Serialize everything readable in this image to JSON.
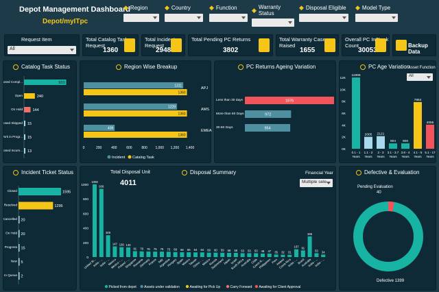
{
  "header": {
    "title": "Depot Management Dashboard",
    "subtitle": "Depot/myITpc"
  },
  "filters": [
    {
      "label": "Region",
      "icon": "map-pin-icon"
    },
    {
      "label": "Country",
      "icon": "globe-icon"
    },
    {
      "label": "Function",
      "icon": "function-icon"
    },
    {
      "label": "Warranty Status",
      "icon": "warranty-icon"
    },
    {
      "label": "Disposal Eligible",
      "icon": "disposal-icon"
    },
    {
      "label": "Model Type",
      "icon": "model-icon"
    }
  ],
  "request_item": {
    "label": "Request Item",
    "value": "All"
  },
  "kpis": [
    {
      "label": "Total Catalog Task Request",
      "value": "1360"
    },
    {
      "label": "Total Incident Request",
      "value": "2948"
    },
    {
      "label": "Total Pending PC Returns",
      "value": "3802"
    },
    {
      "label": "Total Warranty Case Raised",
      "value": "1655"
    },
    {
      "label": "Overall PC InStock Count",
      "value": "30053"
    }
  ],
  "backup": {
    "label": "Backup Data"
  },
  "colors": {
    "teal": "#17b3a3",
    "yellow": "#f5c518",
    "coral": "#f0706a",
    "lightblue": "#a7d8ec",
    "red": "#f2545b",
    "steel": "#4e8fa0",
    "panel": "#0e2a36",
    "bg": "#1c3a48"
  },
  "catalog_task": {
    "title": "Catalog Task Status",
    "chart_data": {
      "type": "bar",
      "categories": [
        "Closed Compl...",
        "Open",
        "On Hold",
        "Closed Skipped",
        "Work in Progr...",
        "Closed Incom..."
      ],
      "values": [
        933,
        240,
        144,
        15,
        15,
        13
      ]
    }
  },
  "region": {
    "title": "Region Wise Breakup",
    "legend": [
      "Incident",
      "Catalog Task"
    ],
    "chart_data": {
      "type": "bar",
      "categories": [
        "APJ",
        "AMS",
        "EMEA"
      ],
      "series": [
        {
          "name": "Incident",
          "values": [
            1311,
            1229,
            408
          ]
        },
        {
          "name": "Catalog Task",
          "values": [
            1360,
            1360,
            1360
          ]
        }
      ],
      "xticks": [
        "0",
        "200",
        "400",
        "600",
        "800",
        "1,000",
        "1,200",
        "1,400"
      ],
      "xlim": [
        0,
        1400
      ]
    }
  },
  "ageing": {
    "title": "PC Returns Ageing Variation",
    "chart_data": {
      "type": "bar",
      "categories": [
        "Less than 30 days",
        "More than 60 Days",
        "30-60 Days"
      ],
      "values": [
        1876,
        972,
        954
      ]
    }
  },
  "age": {
    "title": "PC Age Variation",
    "filter_label": "Asset Function",
    "filter_value": "All",
    "chart_data": {
      "type": "bar",
      "categories": [
        "0.1 - 1 Years",
        "1.1 - 2 Years",
        "2 - 3 Years",
        "3.1 - 3.7 Years",
        "3.8 - 4 Years",
        "4.1 - 5 Years",
        "5.1 - 17 Years"
      ],
      "values": [
        11998,
        2005,
        2121,
        904,
        906,
        7864,
        4055
      ],
      "yticks": [
        "0K",
        "2K",
        "4K",
        "6K",
        "8K",
        "10K",
        "12K"
      ],
      "ylim": [
        0,
        12000
      ]
    }
  },
  "incident": {
    "title": "Incident Ticket Status",
    "chart_data": {
      "type": "bar",
      "categories": [
        "Closed",
        "Resolved",
        "Cancelled",
        "On Hold",
        "In Progress",
        "New",
        "In Queue"
      ],
      "values": [
        1595,
        1295,
        20,
        20,
        15,
        5,
        2
      ]
    }
  },
  "disposal": {
    "title": "Disposal Summary",
    "total_label": "Total Disposal Unit",
    "total_value": "4011",
    "year_label": "Financial Year",
    "year_value": "Multiple sele...",
    "legend": [
      "Picked from depot",
      "Assets under validation",
      "Awaiting for Pick Up",
      "Carry Forward",
      "Awaiting for Client Approval"
    ],
    "chart_data": {
      "type": "bar",
      "categories": [
        "United St...",
        "India - ...",
        "India - ...",
        "Mexico",
        "Mexico - ...",
        "Poland - ...",
        "Singapore",
        "Romania",
        "Germany",
        "France",
        "Italy",
        "Argentina",
        "Hungary",
        "Spain",
        "Mexico",
        "Taiwan",
        "China - ...",
        "Mexico",
        "Russia",
        "Switzerland",
        "Japan",
        "Israel",
        "South Africa",
        "Australia",
        "Chile",
        "Czech R...",
        "Philippines",
        "Peru",
        "Ireland",
        "Costa Rica",
        "India - ...",
        "Brazil",
        "Australia",
        "India - ...",
        "India - ..."
      ],
      "values": [
        1008,
        939,
        300,
        147,
        136,
        133,
        81,
        78,
        76,
        75,
        75,
        73,
        69,
        66,
        66,
        64,
        64,
        60,
        60,
        59,
        58,
        58,
        53,
        53,
        53,
        48,
        47,
        35,
        32,
        31,
        107,
        91,
        285,
        53,
        34
      ],
      "yticks": [
        "0",
        "200",
        "400",
        "600",
        "800",
        "1000"
      ],
      "ylim": [
        0,
        1000
      ]
    }
  },
  "defect": {
    "title": "Defective & Evaluation",
    "chart_data": {
      "type": "pie",
      "categories": [
        "Pending Evaluation",
        "Defective"
      ],
      "values": [
        40,
        1399
      ]
    },
    "pending_label": "Pending Evaluation",
    "pending_value": "40",
    "defective_label": "Defective 1399"
  }
}
